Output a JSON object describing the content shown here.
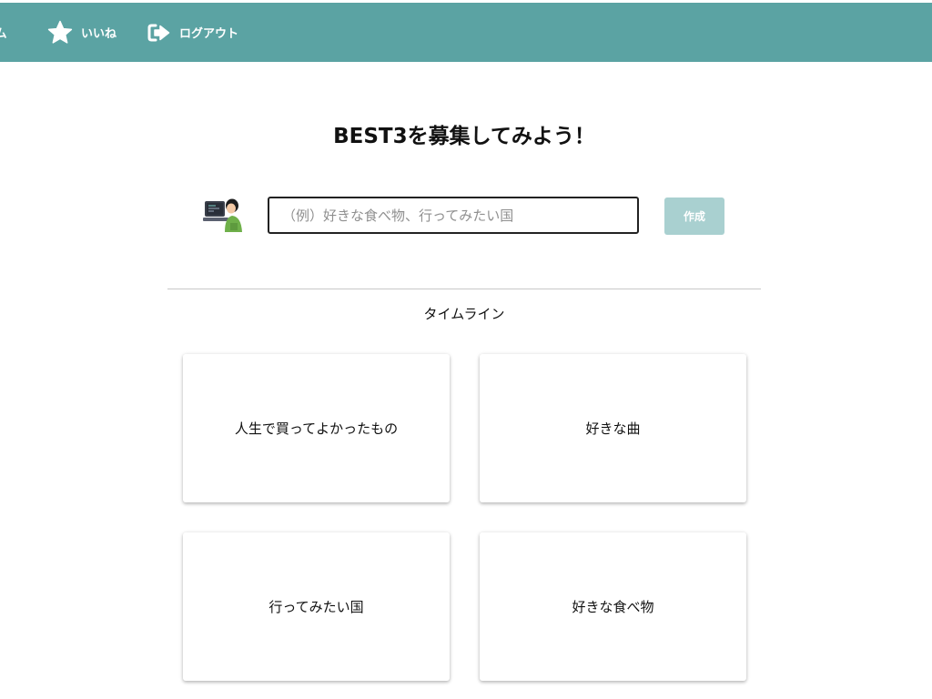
{
  "nav": {
    "home_label": "ーム",
    "like_label": "いいね",
    "like_icon": "star-icon",
    "logout_label": "ログアウト",
    "logout_icon": "logout-icon",
    "bar_color": "#5ba3a3"
  },
  "main": {
    "title": "BEST3を募集してみよう！",
    "input": {
      "value": "",
      "placeholder": "（例）好きな食べ物、行ってみたい国"
    },
    "create_button_label": "作成",
    "create_button_color": "#a9d0d0"
  },
  "timeline": {
    "heading": "タイムライン",
    "cards": [
      {
        "title": "人生で買ってよかったもの"
      },
      {
        "title": "好きな曲"
      },
      {
        "title": "行ってみたい国"
      },
      {
        "title": "好きな食べ物"
      }
    ]
  }
}
